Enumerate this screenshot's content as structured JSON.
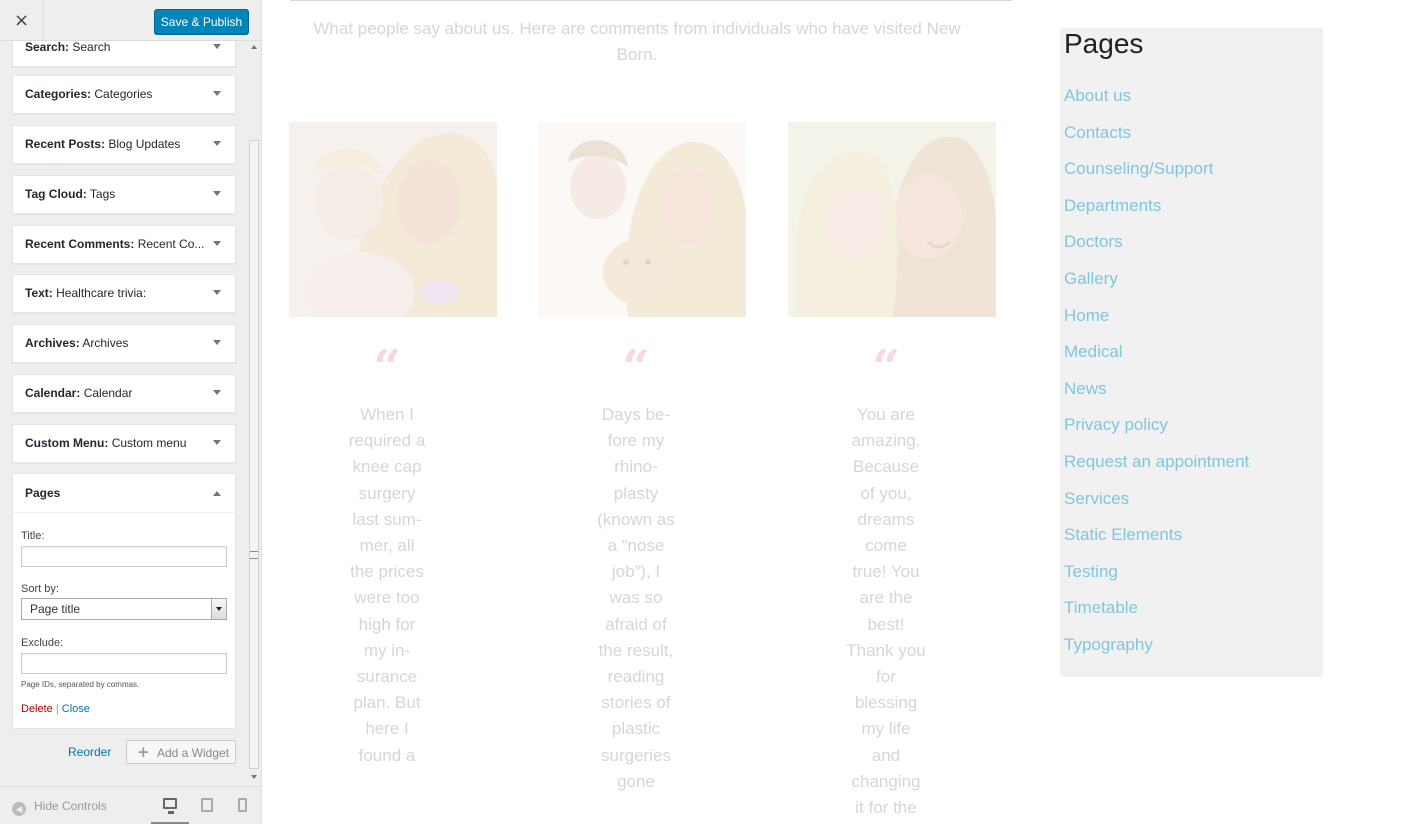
{
  "header": {
    "save_label": "Save & Publish",
    "close_icon": "×"
  },
  "widgets": [
    {
      "type": "Search",
      "title": "Search"
    },
    {
      "type": "Categories",
      "title": "Categories"
    },
    {
      "type": "Recent Posts",
      "title": "Blog Updates"
    },
    {
      "type": "Tag Cloud",
      "title": "Tags"
    },
    {
      "type": "Recent Comments",
      "title": "Recent Co..."
    },
    {
      "type": "Text",
      "title": "Healthcare trivia:"
    },
    {
      "type": "Archives",
      "title": "Archives"
    },
    {
      "type": "Calendar",
      "title": "Calendar"
    },
    {
      "type": "Custom Menu",
      "title": "Custom menu"
    }
  ],
  "pages_widget": {
    "title": "Pages",
    "title_label": "Title:",
    "title_value": "",
    "sort_label": "Sort by:",
    "sort_value": "Page title",
    "exclude_label": "Exclude:",
    "exclude_value": "",
    "hint": "Page IDs, separated by commas.",
    "delete_label": "Delete",
    "separator": "|",
    "close_label": "Close"
  },
  "actions": {
    "reorder_label": "Reorder",
    "add_widget_label": "Add a Widget"
  },
  "footer": {
    "hide_controls_label": "Hide Controls"
  },
  "preview": {
    "intro": "What people say about us. Here are comments from individuals who have visited New Born.",
    "testimonials": [
      {
        "text": "When I required a knee cap surgery last sum-mer, all the prices were too high for my in-surance plan. But here I found a"
      },
      {
        "text": "Days be-fore my rhino-plasty (known as a “nose job”), I was so afraid of the result, reading stories of plastic surgeries gone"
      },
      {
        "text": "You are amazing. Because of you, dreams come true! You are the best! Thank you for blessing my life and changing it for the"
      }
    ],
    "pages_heading": "Pages",
    "pages": [
      "About us",
      "Contacts",
      "Counseling/Support",
      "Departments",
      "Doctors",
      "Gallery",
      "Home",
      "Medical",
      "News",
      "Privacy policy",
      "Request an appointment",
      "Services",
      "Static Elements",
      "Testing",
      "Timetable",
      "Typography"
    ]
  },
  "colors": {
    "accent": "#0085ba",
    "link": "#7fc6de",
    "quote": "#f8d8df",
    "delete": "#aa0000"
  }
}
